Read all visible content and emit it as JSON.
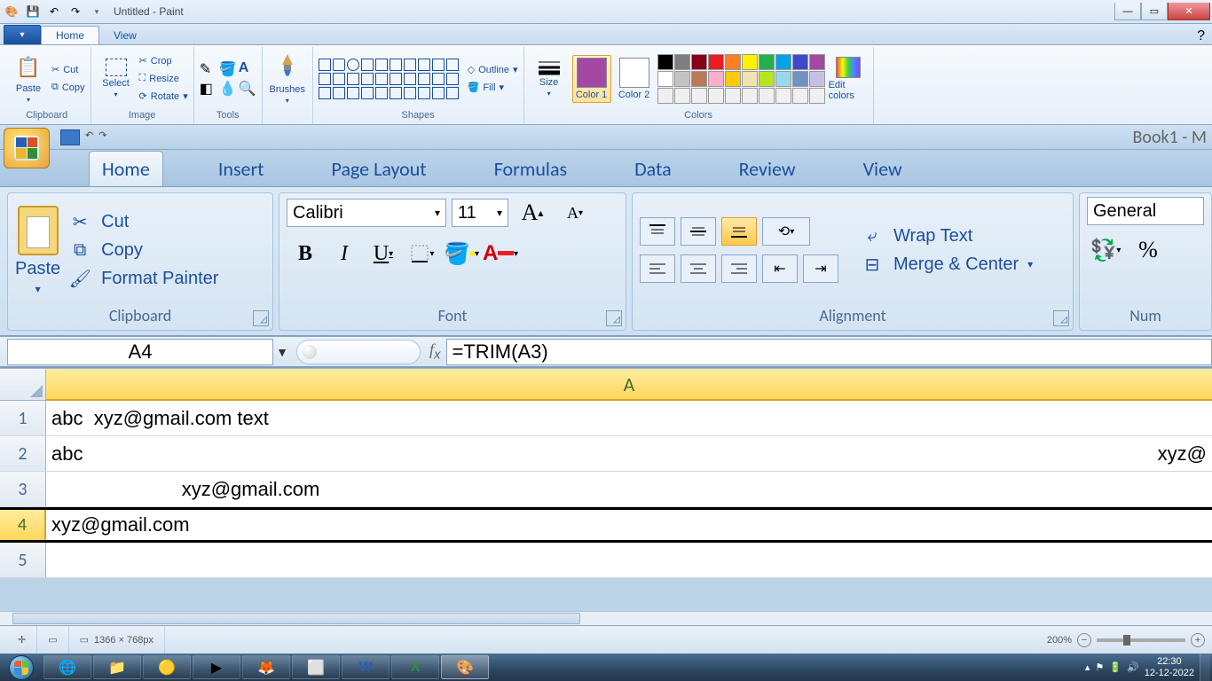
{
  "titlebar": {
    "app_title": "Untitled - Paint"
  },
  "paint_tabs": {
    "file": "▾",
    "home": "Home",
    "view": "View"
  },
  "paint_ribbon": {
    "paste": "Paste",
    "cut": "Cut",
    "copy": "Copy",
    "select": "Select",
    "crop": "Crop",
    "resize": "Resize",
    "rotate": "Rotate",
    "brushes": "Brushes",
    "outline": "Outline",
    "fill": "Fill",
    "size": "Size",
    "color1": "Color 1",
    "color2": "Color 2",
    "edit_colors": "Edit colors",
    "groups": {
      "clipboard": "Clipboard",
      "image": "Image",
      "tools": "Tools",
      "shapes": "Shapes",
      "colors": "Colors"
    },
    "color1_hex": "#a349a4",
    "color2_hex": "#ffffff",
    "palette": [
      "#000000",
      "#7f7f7f",
      "#880015",
      "#ed1c24",
      "#ff7f27",
      "#fff200",
      "#22b14c",
      "#00a2e8",
      "#3f48cc",
      "#a349a4",
      "#ffffff",
      "#c3c3c3",
      "#b97a57",
      "#ffaec9",
      "#ffc90e",
      "#efe4b0",
      "#b5e61d",
      "#99d9ea",
      "#7092be",
      "#c8bfe7",
      "#f0f0f0",
      "#f0f0f0",
      "#f0f0f0",
      "#f0f0f0",
      "#f0f0f0",
      "#f0f0f0",
      "#f0f0f0",
      "#f0f0f0",
      "#f0f0f0",
      "#f0f0f0"
    ]
  },
  "excel": {
    "book": "Book1 - M",
    "tabs": [
      "Home",
      "Insert",
      "Page Layout",
      "Formulas",
      "Data",
      "Review",
      "View"
    ],
    "active_tab": "Home",
    "clipboard": {
      "paste": "Paste",
      "cut": "Cut",
      "copy": "Copy",
      "format_painter": "Format Painter",
      "name": "Clipboard"
    },
    "font": {
      "name": "Font",
      "family": "Calibri",
      "size": "11"
    },
    "alignment": {
      "name": "Alignment",
      "wrap": "Wrap Text",
      "merge": "Merge & Center"
    },
    "number": {
      "name": "Num",
      "format": "General"
    },
    "namebox": "A4",
    "formula": "=TRIM(A3)",
    "col_header": "A",
    "rows": [
      {
        "n": "1",
        "val": "abc  xyz@gmail.com text",
        "spill": ""
      },
      {
        "n": "2",
        "val": "abc",
        "spill": "xyz@"
      },
      {
        "n": "3",
        "val": "                        xyz@gmail.com",
        "spill": ""
      },
      {
        "n": "4",
        "val": "xyz@gmail.com",
        "spill": ""
      },
      {
        "n": "5",
        "val": "",
        "spill": ""
      }
    ],
    "selected_row": 4
  },
  "paint_status": {
    "dims": "1366 × 768px",
    "zoom": "200%"
  },
  "taskbar": {
    "time": "22:30",
    "date": "12-12-2022"
  }
}
